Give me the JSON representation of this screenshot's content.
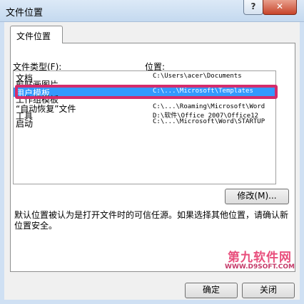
{
  "window": {
    "title": "文件位置",
    "help": "?",
    "close": "✕"
  },
  "tabs": [
    {
      "label": "文件位置"
    }
  ],
  "labels": {
    "file_types": "文件类型(F):",
    "location": "位置:"
  },
  "file_list": [
    {
      "type": "文档",
      "path": "C:\\Users\\acer\\Documents",
      "selected": false
    },
    {
      "type": "剪贴画图片",
      "path": "",
      "selected": false
    },
    {
      "type": "用户模板",
      "path": "C:\\...\\Microsoft\\Templates",
      "selected": true
    },
    {
      "type": "工作组模板",
      "path": "",
      "selected": false
    },
    {
      "type": "“自动恢复”文件",
      "path": "C:\\...\\Roaming\\Microsoft\\Word",
      "selected": false
    },
    {
      "type": "工具",
      "path": "D:\\软件\\Office 2007\\Office12",
      "selected": false
    },
    {
      "type": "启动",
      "path": "C:\\...\\Microsoft\\Word\\STARTUP",
      "selected": false
    }
  ],
  "buttons": {
    "modify": "修改(M)...",
    "ok": "确定",
    "cancel": "关闭"
  },
  "note": "默认位置被认为是打开文件时的可信任源。如果选择其他位置，请确认新位置安全。",
  "watermark": {
    "title": "第九软件网",
    "url": "WWW.D9SOFT.COM"
  },
  "colors": {
    "selection": "#3399ff",
    "highlight_box": "#d42c6b"
  }
}
